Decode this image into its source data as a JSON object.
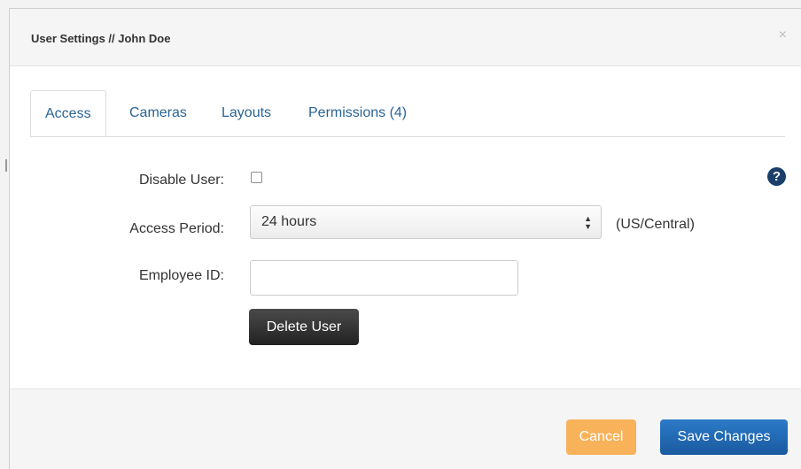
{
  "modal": {
    "title": "User Settings // John Doe",
    "close_glyph": "×",
    "close_icon": "close-icon"
  },
  "tabs": [
    {
      "label": "Access",
      "active": true
    },
    {
      "label": "Cameras",
      "active": false
    },
    {
      "label": "Layouts",
      "active": false
    },
    {
      "label": "Permissions (4)",
      "active": false
    }
  ],
  "form": {
    "disable_user": {
      "label": "Disable User:",
      "checked": false
    },
    "access_period": {
      "label": "Access Period:",
      "value": "24 hours",
      "timezone": "(US/Central)"
    },
    "employee_id": {
      "label": "Employee ID:",
      "value": ""
    },
    "delete_label": "Delete User",
    "help_glyph": "?"
  },
  "footer": {
    "cancel_label": "Cancel",
    "save_label": "Save Changes"
  },
  "colors": {
    "link": "#2a6496",
    "cancel": "#f7b25a",
    "save": "#1f6bb5",
    "help": "#1b3f6b"
  }
}
